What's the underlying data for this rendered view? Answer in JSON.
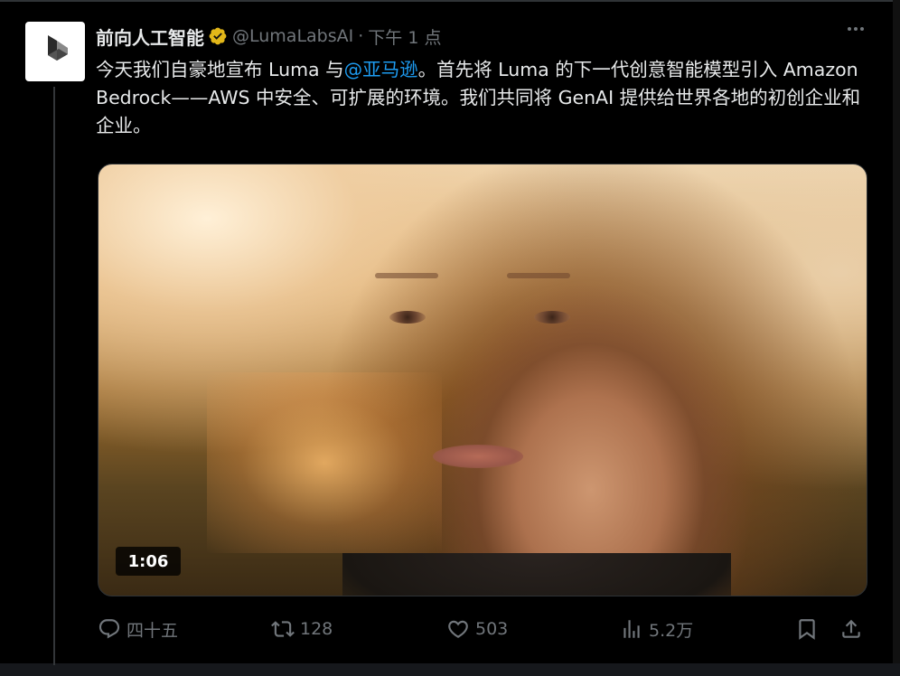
{
  "tweet": {
    "display_name": "前向人工智能",
    "verified_icon": "verified-gold-badge-icon",
    "handle": "@LumaLabsAI",
    "separator": "·",
    "timestamp": "下午 1 点",
    "text_parts": [
      "今天我们自豪地宣布 Luma 与",
      "@亚马逊",
      "。首先将 Luma 的下一代创意智能模型引入 Amazon Bedrock——AWS 中安全、可扩展的环境。我们共同将 GenAI 提供给世界各地的初创企业和企业。"
    ],
    "media": {
      "type": "video",
      "duration": "1:06"
    },
    "actions": {
      "reply_count": "四十五",
      "retweet_count": "128",
      "like_count": "503",
      "views_count": "5.2万"
    }
  },
  "colors": {
    "background": "#000000",
    "text": "#e7e9ea",
    "muted": "#71767b",
    "mention": "#1d9bf0",
    "verified": "#e2b719"
  },
  "icons": {
    "avatar": "luma-logo-icon",
    "more": "more-dots-icon",
    "reply": "reply-bubble-icon",
    "retweet": "retweet-icon",
    "like": "heart-icon",
    "views": "views-bar-chart-icon",
    "bookmark": "bookmark-icon",
    "share": "share-upload-icon"
  }
}
